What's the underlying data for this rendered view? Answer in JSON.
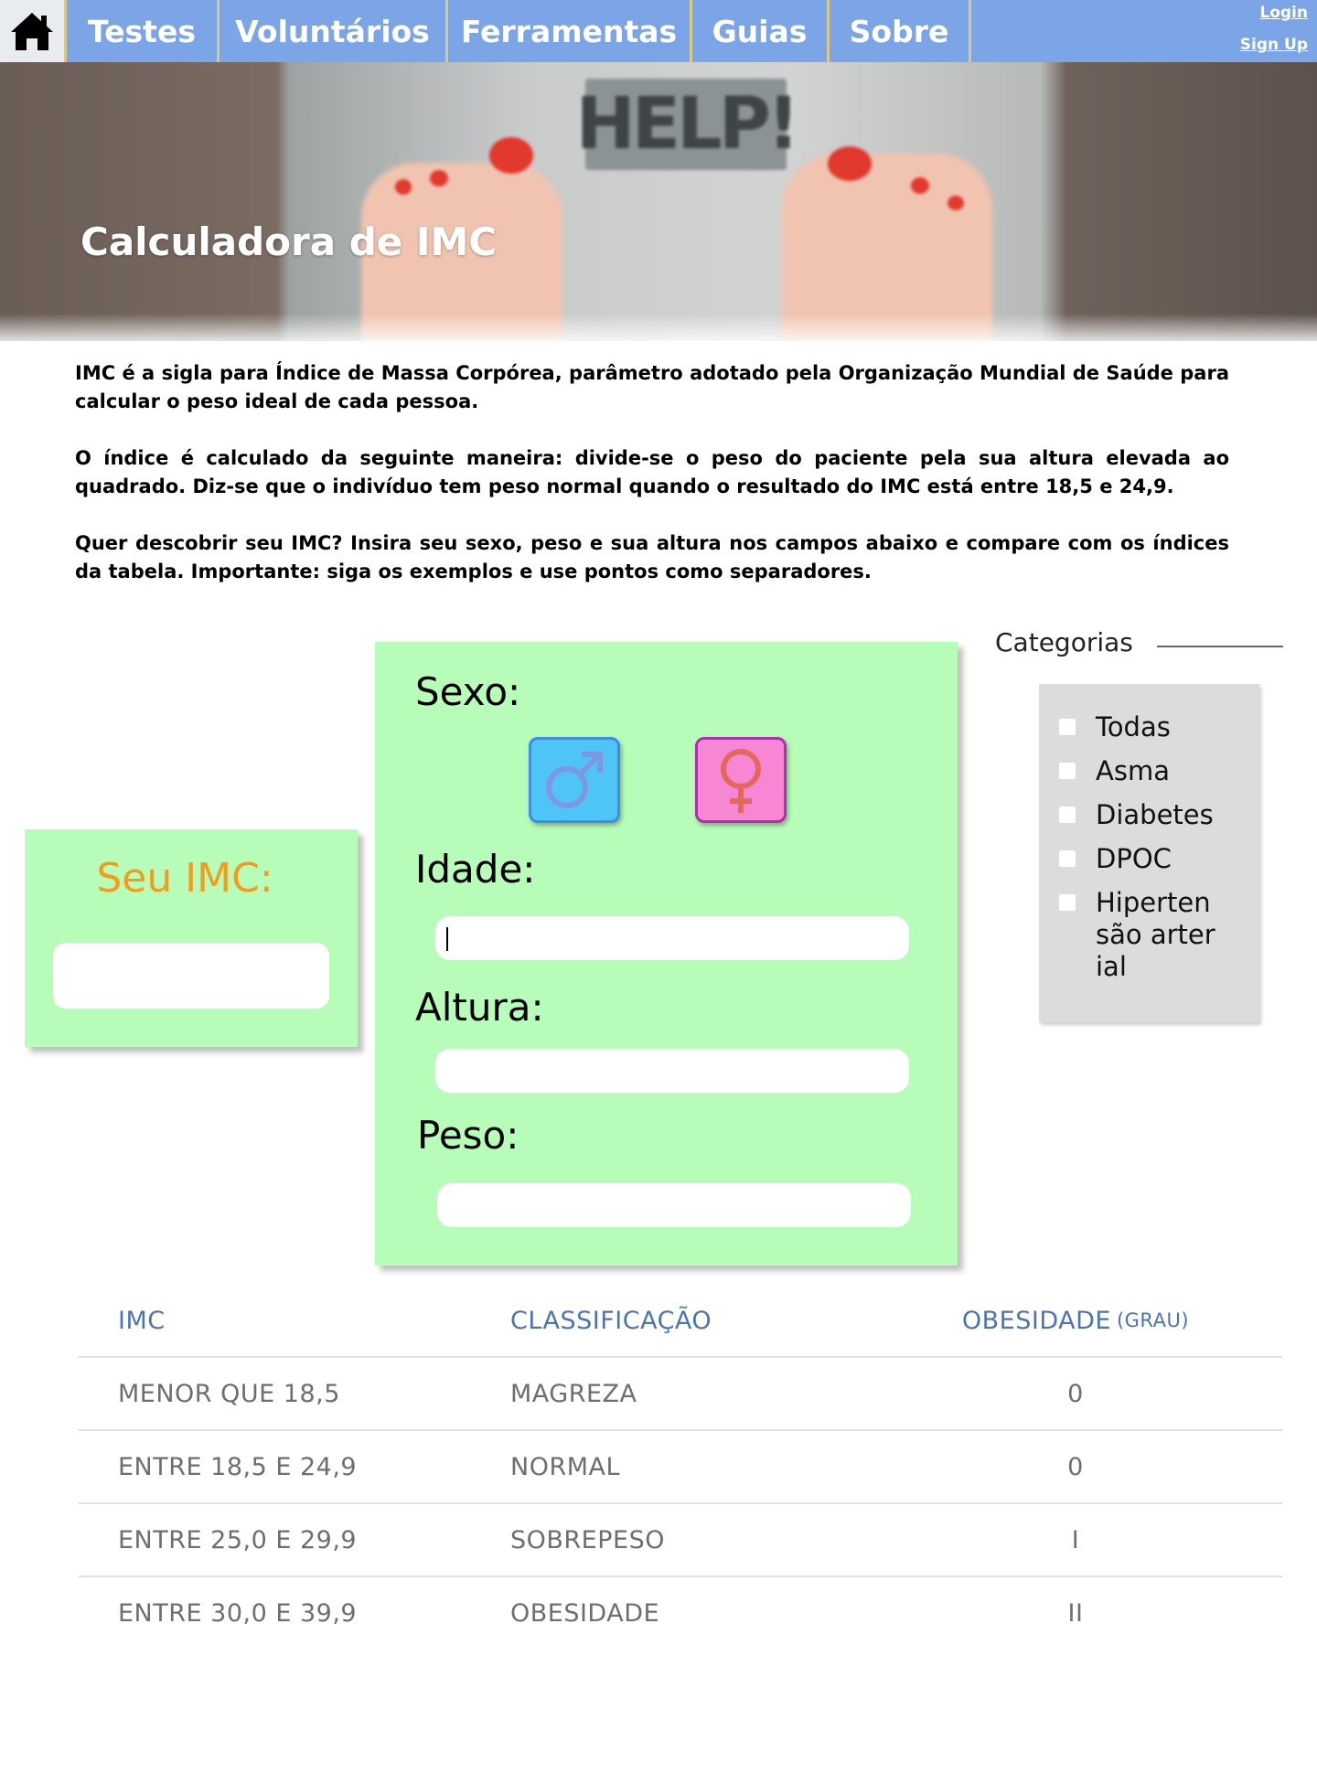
{
  "nav": {
    "home_icon": "home-icon",
    "items": [
      "Testes",
      "Voluntários",
      "Ferramentas",
      "Guias",
      "Sobre"
    ],
    "login": "Login",
    "signup": "Sign Up"
  },
  "hero": {
    "title": "Calculadora de IMC",
    "scale_display": "HELP!"
  },
  "intro": {
    "p1": "IMC é a sigla para Índice de Massa Corpórea, parâmetro adotado pela Organização Mundial de Saúde para calcular o peso ideal de cada pessoa.",
    "p2": "O índice é calculado da seguinte maneira: divide-se o peso do paciente pela sua altura elevada ao quadrado. Diz-se que o indivíduo tem peso normal quando o resultado do IMC está entre 18,5 e 24,9.",
    "p3": "Quer descobrir seu IMC? Insira seu sexo, peso e sua altura nos campos abaixo e compare com os índices da tabela. Importante: siga os exemplos e use pontos como separadores."
  },
  "calculator": {
    "sex_label": "Sexo:",
    "male_icon": "male-symbol-icon",
    "female_icon": "female-symbol-icon",
    "age_label": "Idade:",
    "height_label": "Altura:",
    "weight_label": "Peso:",
    "age_value": "",
    "height_value": "",
    "weight_value": ""
  },
  "result": {
    "title": "Seu IMC:",
    "value": ""
  },
  "categories": {
    "heading": "Categorias",
    "items": [
      "Todas",
      "Asma",
      "Diabetes",
      "DPOC",
      "Hipertensão arterial"
    ]
  },
  "table": {
    "headers": [
      "IMC",
      "CLASSIFICAÇÃO",
      "OBESIDADE",
      "(GRAU)"
    ],
    "rows": [
      [
        "MENOR QUE 18,5",
        "MAGREZA",
        "0"
      ],
      [
        "ENTRE 18,5 E 24,9",
        "NORMAL",
        "0"
      ],
      [
        "ENTRE 25,0 E 29,9",
        "SOBREPESO",
        "I"
      ],
      [
        "ENTRE 30,0 E 39,9",
        "OBESIDADE",
        "II"
      ]
    ]
  },
  "colors": {
    "nav_bg": "#7ba5e6",
    "panel_green": "#b7fcb9",
    "result_title": "#f59b1c",
    "male_button": "#4fc4f7",
    "female_button": "#f787d4",
    "table_header": "#4b73b8"
  }
}
